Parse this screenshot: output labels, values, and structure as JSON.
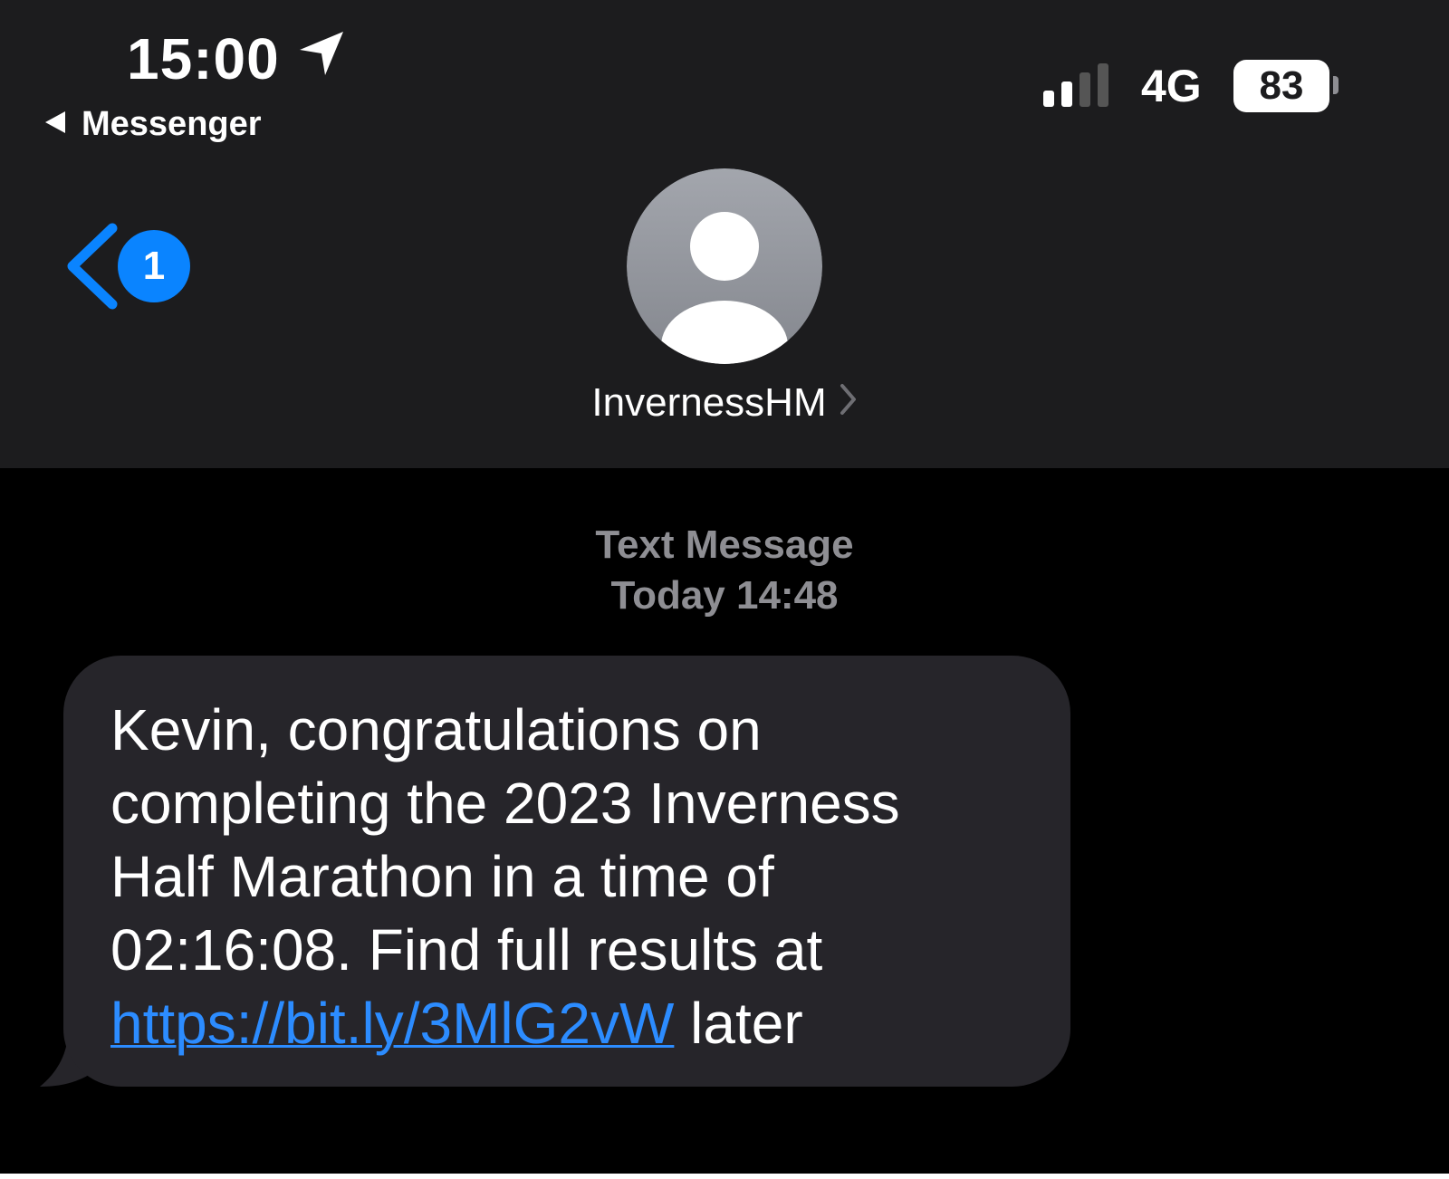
{
  "status_bar": {
    "time": "15:00",
    "back_app": "Messenger",
    "network": "4G",
    "battery": "83",
    "location_icon": "location-arrow-icon",
    "signal_icon": "signal-bars-icon"
  },
  "nav": {
    "back_icon": "chevron-left-icon",
    "unread_count": "1",
    "contact_name": "InvernessHM",
    "avatar_icon": "person-placeholder-icon"
  },
  "thread": {
    "message_type": "Text Message",
    "timestamp": "Today 14:48"
  },
  "message": {
    "line1": "Kevin, congratulations on",
    "line2": "completing the 2023 Inverness",
    "line3": "Half Marathon in a time of",
    "line4": "02:16:08. Find full results at",
    "link": "https://bit.ly/3MlG2vW",
    "after_link": " later"
  },
  "colors": {
    "header_bg": "#1c1c1e",
    "bubble_bg": "#26252a",
    "accent": "#0a84ff",
    "link": "#2c8cff"
  }
}
